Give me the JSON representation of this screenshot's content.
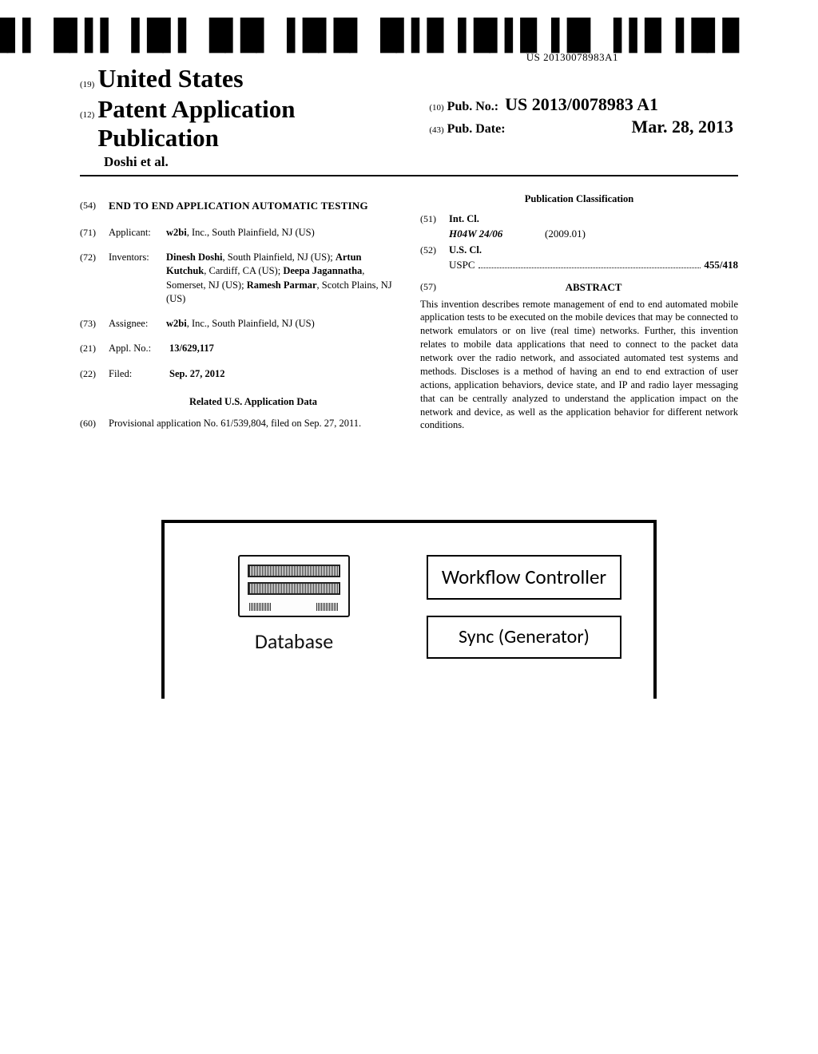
{
  "barcode_number": "US 20130078983A1",
  "header": {
    "code_19": "(19)",
    "country": "United States",
    "code_12": "(12)",
    "doc_type": "Patent Application Publication",
    "authors_line": "Doshi et al.",
    "code_10": "(10)",
    "pub_no_label": "Pub. No.:",
    "pub_no": "US 2013/0078983 A1",
    "code_43": "(43)",
    "pub_date_label": "Pub. Date:",
    "pub_date": "Mar. 28, 2013"
  },
  "left": {
    "code_54": "(54)",
    "title": "END TO END APPLICATION AUTOMATIC TESTING",
    "code_71": "(71)",
    "applicant_label": "Applicant:",
    "applicant": "w2bi, Inc., South Plainfield, NJ (US)",
    "code_72": "(72)",
    "inventors_label": "Inventors:",
    "inventors": [
      {
        "name": "Dinesh Doshi",
        "rest": ", South Plainfield, NJ (US);"
      },
      {
        "name": "Artun Kutchuk",
        "rest": ", Cardiff, CA (US);"
      },
      {
        "name": "Deepa Jagannatha",
        "rest": ", Somerset, NJ (US);"
      },
      {
        "name": "Ramesh Parmar",
        "rest": ", Scotch Plains, NJ (US)"
      }
    ],
    "code_73": "(73)",
    "assignee_label": "Assignee:",
    "assignee": "w2bi, Inc., South Plainfield, NJ (US)",
    "code_21": "(21)",
    "applno_label": "Appl. No.:",
    "applno": "13/629,117",
    "code_22": "(22)",
    "filed_label": "Filed:",
    "filed": "Sep. 27, 2012",
    "related_heading": "Related U.S. Application Data",
    "code_60": "(60)",
    "provisional": "Provisional application No. 61/539,804, filed on Sep. 27, 2011."
  },
  "right": {
    "pubclass_heading": "Publication Classification",
    "code_51": "(51)",
    "intcl_label": "Int. Cl.",
    "intcl_code": "H04W 24/06",
    "intcl_date": "(2009.01)",
    "code_52": "(52)",
    "uscl_label": "U.S. Cl.",
    "uspc_label": "USPC",
    "uspc_val": "455/418",
    "code_57": "(57)",
    "abstract_heading": "ABSTRACT",
    "abstract": "This invention describes remote management of end to end automated mobile application tests to be executed on the mobile devices that may be connected to network emulators or on live (real time) networks. Further, this invention relates to mobile data applications that need to connect to the packet data network over the radio network, and associated automated test systems and methods. Discloses is a method of having an end to end extraction of user actions, application behaviors, device state, and IP and radio layer messaging that can be centrally analyzed to understand the application impact on the network and device, as well as the application behavior for different network conditions."
  },
  "figure": {
    "database": "Database",
    "workflow": "Workflow Controller",
    "sync": "Sync (Generator)"
  }
}
